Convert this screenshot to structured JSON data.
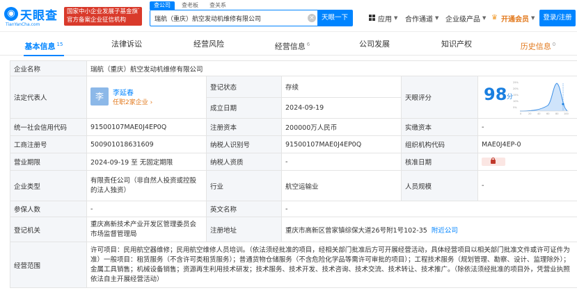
{
  "header": {
    "logo_text": "天眼查",
    "logo_sub": "TianYanCha.com",
    "badge_line1": "国家中小企业发展子基金旗下",
    "badge_line2": "官方备案企业征信机构",
    "search_tabs": [
      "查公司",
      "查老板",
      "查关系"
    ],
    "search_value": "瑞航（重庆）航空发动机维修有限公司",
    "search_button": "天眼一下",
    "nav_app": "应用",
    "nav_coop": "合作通道",
    "nav_ent": "企业级产品",
    "nav_vip": "开通会员",
    "login": "登录/注册"
  },
  "tabs": {
    "basic": "基本信息",
    "basic_count": "15",
    "legal": "法律诉讼",
    "risk": "经营风险",
    "biz": "经营信息",
    "biz_count": "6",
    "dev": "公司发展",
    "ip": "知识产权",
    "history": "历史信息",
    "history_count": "0"
  },
  "table": {
    "company_name_label": "企业名称",
    "company_name": "瑞航（重庆）航空发动机维修有限公司",
    "legal_rep_label": "法定代表人",
    "avatar": "李",
    "legal_rep": "李延春",
    "legal_rep_sub": "任职2家企业 ›",
    "status_label": "登记状态",
    "status": "存续",
    "founded_label": "成立日期",
    "founded": "2024-09-19",
    "score_label": "天眼评分",
    "score": "98",
    "score_unit": "分",
    "credit_code_label": "统一社会信用代码",
    "credit_code": "91500107MAE0J4EP0Q",
    "reg_capital_label": "注册资本",
    "reg_capital": "200000万人民币",
    "paid_capital_label": "实缴资本",
    "paid_capital": "-",
    "reg_no_label": "工商注册号",
    "reg_no": "500901018631609",
    "taxpayer_id_label": "纳税人识别号",
    "taxpayer_id": "91500107MAE0J4EP0Q",
    "org_code_label": "组织机构代码",
    "org_code": "MAE0J4EP-0",
    "term_label": "营业期限",
    "term": "2024-09-19 至 无固定期限",
    "taxpayer_qual_label": "纳税人资质",
    "taxpayer_qual": "-",
    "approval_date_label": "核准日期",
    "type_label": "企业类型",
    "type": "有限责任公司（非自然人投资或控股的法人独资）",
    "industry_label": "行业",
    "industry": "航空运输业",
    "staff_label": "人员规模",
    "staff": "-",
    "insured_label": "参保人数",
    "insured": "-",
    "en_name_label": "英文名称",
    "en_name": "-",
    "authority_label": "登记机关",
    "authority": "重庆高新技术产业开发区管理委员会市场监督管理局",
    "address_label": "注册地址",
    "address": "重庆市高新区曾家镇综保大道26号附1号102-35",
    "nearby": "附近公司",
    "scope_label": "经营范围",
    "scope": "许可项目：民用航空器维修；民用航空维修人员培训。（依法须经批准的项目，经相关部门批准后方可开展经营活动，具体经营项目以相关部门批准文件或许可证件为准）一般项目：租赁服务（不含许可类租赁服务）；普通货物仓储服务（不含危险化学品等需许可审批的项目）；工程技术服务（规划管理、勘察、设计、监理除外）；金属工具销售；机械设备销售；资源再生利用技术研发；技术服务、技术开发、技术咨询、技术交流、技术转让、技术推广。（除依法须经批准的项目外，凭营业执照依法自主开展经营活动）"
  },
  "score_chart": {
    "x_ticks": [
      "0",
      "20",
      "40",
      "60",
      "80",
      "100"
    ],
    "y_ticks": [
      "25%",
      "20%",
      "15%",
      "10%",
      "5%"
    ]
  },
  "colors": {
    "accent": "#0084ff",
    "badge": "#d93a2b",
    "vip": "#e2781b",
    "status": "#00a14b"
  }
}
